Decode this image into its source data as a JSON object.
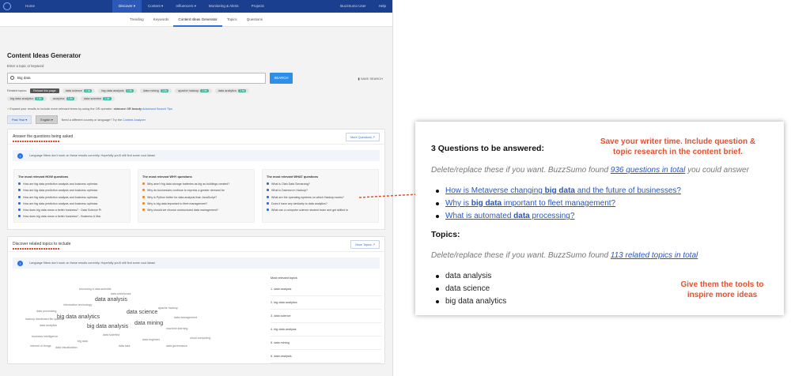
{
  "app": {
    "topbar": {
      "home": "Home",
      "nav": [
        "Discover ▾",
        "Content ▾",
        "Influencers ▾",
        "Monitoring & Alerts",
        "Projects"
      ],
      "user": "BuzzSumo User",
      "help": "Help"
    },
    "subnav": [
      "Trending",
      "Keywords",
      "Content Ideas Generator",
      "Topics",
      "Questions"
    ],
    "page_title": "Content Ideas Generator",
    "enter_label": "Enter a topic or keyword",
    "search": {
      "value": "Big data",
      "button": "SEARCH",
      "save": "SAVE SEARCH"
    },
    "related": {
      "label": "Related topics:",
      "tooltip": "Reload this page",
      "pills": [
        {
          "label": "data science",
          "count": "2,8k"
        },
        {
          "label": "big data analysis",
          "count": "2,8k"
        },
        {
          "label": "data mining",
          "count": "2,8k"
        },
        {
          "label": "apache hadoop",
          "count": "2,8k"
        },
        {
          "label": "data analytics",
          "count": "2,8k"
        },
        {
          "label": "big data analytics",
          "count": "2,8k"
        },
        {
          "label": "analytics",
          "count": "2,8k"
        },
        {
          "label": "data scientist",
          "count": "2,8k"
        }
      ]
    },
    "expand_hint": "Expand your results to include more relevant terms by using the OR operator:",
    "expand_example": "skincare OR beauty",
    "advanced_tips": "Advanced Search Tips",
    "filters": {
      "period": "Past Year ▾",
      "language": "English ▾",
      "country_hint": "Need a different country or language? Try the",
      "country_link": "Content Analyzer"
    },
    "questions_card": {
      "title": "Answer the questions being asked",
      "more_btn": "More Questions ↗",
      "info": "Language filters don't work on these results currently. Hopefully you'll still find some cool ideas!",
      "how_title": "The most relevant HOW questions",
      "how": [
        "How are big data prediction analysis and business optimiza",
        "How are big data prediction analysis and business optimiza",
        "How are big data prediction analysis and business optimiza",
        "How are big data prediction analysis and business optimiza",
        "How does big data mean a better business? · Data Science Pr",
        "How does big data mean a better business? - Business & Mar"
      ],
      "why_title": "The most relevant WHY questions",
      "why": [
        "Why aren't big data storage batteries as big as buildings created?",
        "Why do businesses continue to express a greater demand for",
        "Why is Python better for data analysis than JavaScript?",
        "Why is big data important to fleet management?",
        "Why should we choose unstructured data management?"
      ],
      "what_title": "The most relevant WHAT questions",
      "what": [
        "What is Olah Data Semarang?",
        "What is Daemon in Hadoop?",
        "What are the operating systems on which Hadoop works?",
        "Does it have any similarity to data analytics?",
        "What can a computer science student team and get skilled in"
      ]
    },
    "topics_card": {
      "title": "Discover related topics to include",
      "more_btn": "More Topics ↗",
      "info": "Language filters don't work on these results currently. Hopefully you'll still find some cool ideas!",
      "most_relevant_title": "Most relevant topics",
      "most_relevant": [
        "1. data analysis",
        "2. big data analytics",
        "3. data science",
        "4. big data analysis",
        "5. data mining",
        "6. data analysts"
      ],
      "cloud": [
        "information technology",
        "data analysis",
        "data science",
        "big data analytics",
        "data mining",
        "big data analysis",
        "data analytics",
        "data scientist",
        "apache hadoop",
        "machine learning",
        "data processing",
        "data lake",
        "big data",
        "data management",
        "data visualization",
        "business intelligence",
        "data engineer",
        "hadoop distributed file system",
        "data warehouse",
        "becoming a data scientist",
        "cloud computing",
        "internet of things",
        "data governance"
      ]
    }
  },
  "doc": {
    "q_title": "3 Questions to be answered:",
    "q_desc_pre": "Delete/replace these if you want. BuzzSumo found ",
    "q_desc_link": "936 questions in total",
    "q_desc_post": " you could answer",
    "questions": [
      {
        "pre": "How is Metaverse changing ",
        "bold": "big data",
        "post": " and the future of businesses?"
      },
      {
        "pre": "Why is ",
        "bold": "big data",
        "post": " important to fleet management?"
      },
      {
        "pre": "What is automated ",
        "bold": "data",
        "post": " processing?"
      }
    ],
    "t_title": "Topics:",
    "t_desc_pre": "Delete/replace these if you want. BuzzSumo found ",
    "t_desc_link": "113 related topics in total",
    "topics": [
      "data analysis",
      "data science",
      "big data analytics"
    ]
  },
  "callouts": {
    "top": "Save your writer time. Include question & topic research in the content brief.",
    "bottom": "Give them the tools to inspire more ideas"
  },
  "colors": {
    "accent": "#e4502e",
    "nav": "#1b3f8f",
    "link": "#2556c7"
  }
}
